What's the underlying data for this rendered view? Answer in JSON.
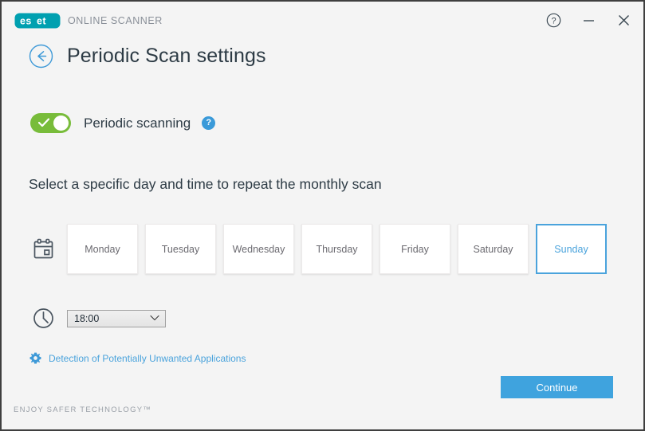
{
  "window": {
    "brand_name": "eset",
    "brand_product": "ONLINE SCANNER",
    "help_icon": "question-circle-icon",
    "minimize_icon": "minimize-icon",
    "close_icon": "close-icon"
  },
  "header": {
    "back_icon": "back-arrow-circle-icon",
    "title": "Periodic Scan settings"
  },
  "periodic_scanning": {
    "label": "Periodic scanning",
    "enabled": true,
    "toggle_state": "on",
    "help_glyph": "?",
    "help_icon": "help-circle-icon",
    "toggle_color": "#78bc3a"
  },
  "instruction": "Select a specific day and time to repeat the monthly scan",
  "day_picker": {
    "icon": "calendar-icon",
    "selected_day": "Sunday",
    "days": [
      {
        "label": "Monday",
        "selected": false
      },
      {
        "label": "Tuesday",
        "selected": false
      },
      {
        "label": "Wednesday",
        "selected": false
      },
      {
        "label": "Thursday",
        "selected": false
      },
      {
        "label": "Friday",
        "selected": false
      },
      {
        "label": "Saturday",
        "selected": false
      },
      {
        "label": "Sunday",
        "selected": true
      }
    ],
    "selected_color": "#4aa3dc"
  },
  "time_picker": {
    "icon": "clock-icon",
    "value": "18:00",
    "chevron_icon": "chevron-down-icon",
    "options": [
      "18:00"
    ]
  },
  "pua": {
    "icon": "gear-icon",
    "label": "Detection of Potentially Unwanted Applications",
    "color": "#4aa3dc"
  },
  "actions": {
    "continue_label": "Continue",
    "continue_color": "#3fa3de"
  },
  "footer": {
    "tagline": "ENJOY SAFER TECHNOLOGY™"
  }
}
